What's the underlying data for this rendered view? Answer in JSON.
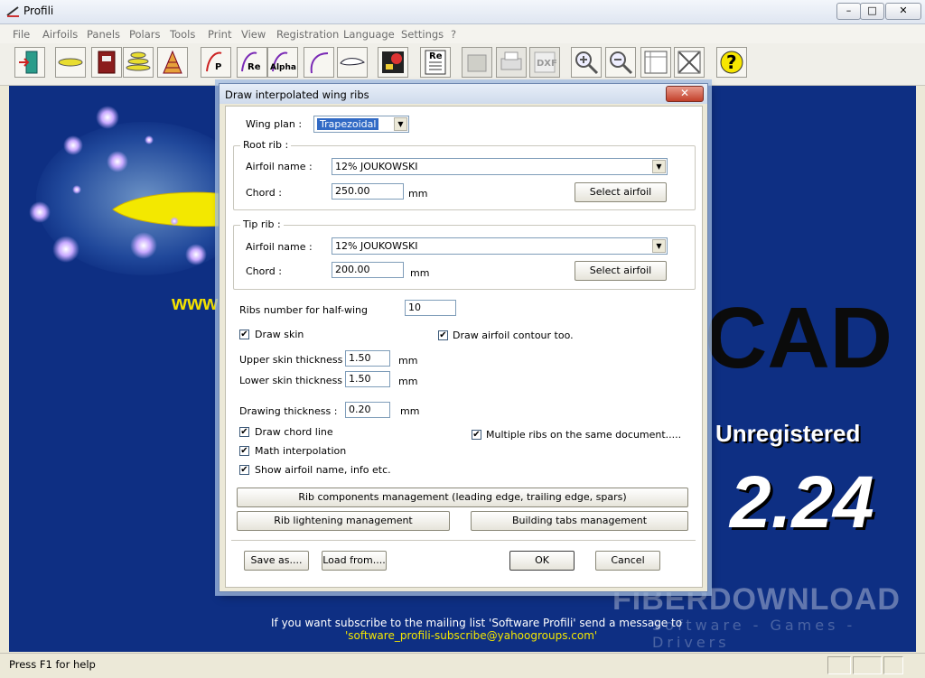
{
  "window": {
    "title": "Profili",
    "minimize": "–",
    "maximize": "□",
    "close": "✕"
  },
  "menu": [
    "File",
    "Airfoils",
    "Panels",
    "Polars",
    "Tools",
    "Print",
    "View",
    "Registration",
    "Language",
    "Settings",
    "?"
  ],
  "toolbar": {
    "re_label": "Re",
    "alpha_label": "Alpha",
    "p_label": "P",
    "dxf_label": "DXF",
    "help_label": "?"
  },
  "splash": {
    "www": "www",
    "cad": "CAD",
    "unregistered": "Unregistered",
    "version": "2.24",
    "mail_line": "If you want subscribe to the mailing list 'Software Profili' send a message to",
    "mail_address": "'software_profili-subscribe@yahoogroups.com'",
    "watermark": "FIBERDOWNLOAD",
    "watermark_sub": "Software - Games - Drivers"
  },
  "status": {
    "text": "Press F1 for help"
  },
  "dialog": {
    "title": "Draw interpolated wing ribs",
    "close": "✕",
    "wing_plan_label": "Wing plan :",
    "wing_plan_value": "Trapezoidal",
    "root": {
      "group_title": "Root rib :",
      "airfoil_label": "Airfoil name :",
      "airfoil_value": "12% JOUKOWSKI",
      "chord_label": "Chord :",
      "chord_value": "250.00",
      "unit": "mm",
      "select_button": "Select airfoil"
    },
    "tip": {
      "group_title": "Tip rib :",
      "airfoil_label": "Airfoil name :",
      "airfoil_value": "12% JOUKOWSKI",
      "chord_label": "Chord :",
      "chord_value": "200.00",
      "unit": "mm",
      "select_button": "Select airfoil"
    },
    "ribs_number_label": "Ribs number for half-wing",
    "ribs_number_value": "10",
    "draw_skin_label": "Draw skin",
    "draw_airfoil_contour_label": "Draw airfoil contour too.",
    "upper_skin_label": "Upper skin thickness :",
    "upper_skin_value": "1.50",
    "lower_skin_label": "Lower skin thickness :",
    "lower_skin_value": "1.50",
    "drawing_thickness_label": "Drawing thickness :",
    "drawing_thickness_value": "0.20",
    "unit": "mm",
    "draw_chord_line_label": "Draw chord line",
    "math_interpolation_label": "Math interpolation",
    "show_airfoil_name_label": "Show airfoil name, info etc.",
    "multiple_ribs_label": "Multiple ribs on the same document.....",
    "check_mark": "✔",
    "rib_components_button": "Rib components management (leading edge, trailing edge, spars)",
    "rib_lightening_button": "Rib lightening management",
    "building_tabs_button": "Building tabs management",
    "save_as_button": "Save as....",
    "load_from_button": "Load from....",
    "ok_button": "OK",
    "cancel_button": "Cancel"
  }
}
